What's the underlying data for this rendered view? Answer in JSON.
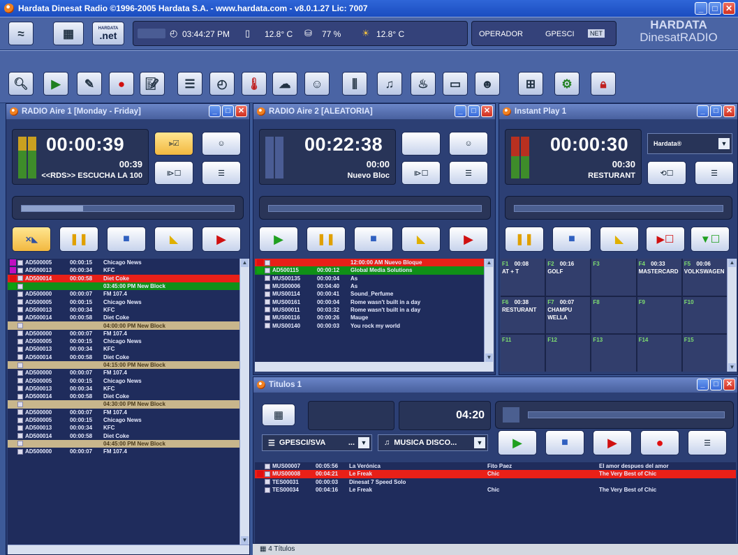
{
  "window": {
    "title": "Hardata Dinesat Radio ©1996-2005 Hardata S.A. - www.hardata.com - v8.0.1.27 Lic: 7007"
  },
  "infobar": {
    "net_label": ".net",
    "net_small": "HARDATA",
    "time": "03:44:27 PM",
    "temp1": "12.8° C",
    "humidity": "77 %",
    "temp2": "12.8° C",
    "operator_label": "OPERADOR",
    "operator": "GPESCI",
    "net_badge": "NET",
    "brand1": "HARDATA",
    "brand2": "DinesatRADIO"
  },
  "panels": {
    "aire1": {
      "title": "RADIO Aire 1 [Monday - Friday]",
      "clock": "00:00:39",
      "small": "00:39",
      "sub": "<<RDS>> ESCUCHA LA 100",
      "progress": 0.29,
      "rows": [
        {
          "icon": "up",
          "id": "AD500005",
          "dur": "00:00:15",
          "name": "Chicago News",
          "style": ""
        },
        {
          "icon": "up",
          "id": "AD500013",
          "dur": "00:00:34",
          "name": "KFC",
          "style": ""
        },
        {
          "icon": "pl",
          "id": "AD500014",
          "dur": "00:00:58",
          "name": "Diet Coke",
          "style": "red"
        },
        {
          "icon": "dn",
          "id": "",
          "dur": "",
          "name": "03:45:00 PM New Block",
          "style": "green"
        },
        {
          "icon": "no",
          "id": "AD500000",
          "dur": "00:00:07",
          "name": "FM 107.4",
          "style": ""
        },
        {
          "icon": "no",
          "id": "AD500005",
          "dur": "00:00:15",
          "name": "Chicago News",
          "style": ""
        },
        {
          "icon": "no",
          "id": "AD500013",
          "dur": "00:00:34",
          "name": "KFC",
          "style": ""
        },
        {
          "icon": "no",
          "id": "AD500014",
          "dur": "00:00:58",
          "name": "Diet Coke",
          "style": ""
        },
        {
          "icon": "no",
          "id": "",
          "dur": "",
          "name": "04:00:00 PM New Block",
          "style": "block"
        },
        {
          "icon": "no",
          "id": "AD500000",
          "dur": "00:00:07",
          "name": "FM 107.4",
          "style": ""
        },
        {
          "icon": "no",
          "id": "AD500005",
          "dur": "00:00:15",
          "name": "Chicago News",
          "style": ""
        },
        {
          "icon": "no",
          "id": "AD500013",
          "dur": "00:00:34",
          "name": "KFC",
          "style": ""
        },
        {
          "icon": "no",
          "id": "AD500014",
          "dur": "00:00:58",
          "name": "Diet Coke",
          "style": ""
        },
        {
          "icon": "no",
          "id": "",
          "dur": "",
          "name": "04:15:00 PM New Block",
          "style": "block"
        },
        {
          "icon": "no",
          "id": "AD500000",
          "dur": "00:00:07",
          "name": "FM 107.4",
          "style": ""
        },
        {
          "icon": "no",
          "id": "AD500005",
          "dur": "00:00:15",
          "name": "Chicago News",
          "style": ""
        },
        {
          "icon": "no",
          "id": "AD500013",
          "dur": "00:00:34",
          "name": "KFC",
          "style": ""
        },
        {
          "icon": "no",
          "id": "AD500014",
          "dur": "00:00:58",
          "name": "Diet Coke",
          "style": ""
        },
        {
          "icon": "no",
          "id": "",
          "dur": "",
          "name": "04:30:00 PM New Block",
          "style": "block"
        },
        {
          "icon": "no",
          "id": "AD500000",
          "dur": "00:00:07",
          "name": "FM 107.4",
          "style": ""
        },
        {
          "icon": "no",
          "id": "AD500005",
          "dur": "00:00:15",
          "name": "Chicago News",
          "style": ""
        },
        {
          "icon": "no",
          "id": "AD500013",
          "dur": "00:00:34",
          "name": "KFC",
          "style": ""
        },
        {
          "icon": "no",
          "id": "AD500014",
          "dur": "00:00:58",
          "name": "Diet Coke",
          "style": ""
        },
        {
          "icon": "no",
          "id": "",
          "dur": "",
          "name": "04:45:00 PM New Block",
          "style": "block"
        },
        {
          "icon": "no",
          "id": "AD500000",
          "dur": "00:00:07",
          "name": "FM 107.4",
          "style": ""
        }
      ]
    },
    "aire2": {
      "title": "RADIO Aire 2 [ALEATORIA]",
      "clock": "00:22:38",
      "small": "00:00",
      "sub": "Nuevo Bloc",
      "progress": 0.0,
      "rows": [
        {
          "icon": "pl",
          "id": "",
          "dur": "",
          "name": "12:00:00 AM Nuevo Bloque",
          "style": "red"
        },
        {
          "icon": "dn",
          "id": "AD500115",
          "dur": "00:00:12",
          "name": "Global Media Solutions",
          "style": "green"
        },
        {
          "icon": "no",
          "id": "MUS00135",
          "dur": "00:00:04",
          "name": "As",
          "style": ""
        },
        {
          "icon": "no",
          "id": "MUS00006",
          "dur": "00:04:40",
          "name": "As",
          "style": ""
        },
        {
          "icon": "no",
          "id": "MUS00114",
          "dur": "00:00:41",
          "name": "Sound_Perfume",
          "style": ""
        },
        {
          "icon": "no",
          "id": "MUS00161",
          "dur": "00:00:04",
          "name": "Rome wasn't built in a day",
          "style": ""
        },
        {
          "icon": "no",
          "id": "MUS00011",
          "dur": "00:03:32",
          "name": "Rome wasn't built in a day",
          "style": ""
        },
        {
          "icon": "no",
          "id": "MUS00116",
          "dur": "00:00:26",
          "name": "Mauge",
          "style": ""
        },
        {
          "icon": "no",
          "id": "MUS00140",
          "dur": "00:00:03",
          "name": "You rock my world",
          "style": ""
        }
      ]
    },
    "instant": {
      "title": "Instant Play 1",
      "clock": "00:00:30",
      "small": "00:30",
      "sub": "RESTURANT",
      "select": "Hardata®",
      "progress": 0.0,
      "cells": [
        {
          "k": "F1",
          "t": "00:08",
          "n": "AT + T"
        },
        {
          "k": "F2",
          "t": "00:16",
          "n": "GOLF"
        },
        {
          "k": "F3",
          "t": "",
          "n": ""
        },
        {
          "k": "F4",
          "t": "00:33",
          "n": "MASTERCARD"
        },
        {
          "k": "F5",
          "t": "00:06",
          "n": "VOLKSWAGEN"
        },
        {
          "k": "F6",
          "t": "00:38",
          "n": "RESTURANT"
        },
        {
          "k": "F7",
          "t": "00:07",
          "n": "CHAMPU WELLA"
        },
        {
          "k": "F8",
          "t": "",
          "n": ""
        },
        {
          "k": "F9",
          "t": "",
          "n": ""
        },
        {
          "k": "F10",
          "t": "",
          "n": ""
        },
        {
          "k": "F11",
          "t": "",
          "n": ""
        },
        {
          "k": "F12",
          "t": "",
          "n": ""
        },
        {
          "k": "F13",
          "t": "",
          "n": ""
        },
        {
          "k": "F14",
          "t": "",
          "n": ""
        },
        {
          "k": "F15",
          "t": "",
          "n": ""
        }
      ]
    },
    "titulos": {
      "title": "Titulos 1",
      "time": "04:20",
      "dd1": "GPESCI/SVA",
      "dd1b": "...",
      "dd2": "MUSICA DISCO...",
      "rows": [
        {
          "icon": "no",
          "id": "MUS00007",
          "dur": "00:05:56",
          "name": "La Verónica",
          "artist": "Fito Paez",
          "album": "El amor despues del amor",
          "style": ""
        },
        {
          "icon": "pl",
          "id": "MUS00008",
          "dur": "00:04:21",
          "name": "Le Freak",
          "artist": "Chic",
          "album": "The Very Best of Chic",
          "style": "red"
        },
        {
          "icon": "no",
          "id": "TES00031",
          "dur": "00:00:03",
          "name": "Dinesat 7 Speed Solo",
          "artist": "",
          "album": "",
          "style": ""
        },
        {
          "icon": "no",
          "id": "TES00034",
          "dur": "00:04:16",
          "name": "Le Freak",
          "artist": "Chic",
          "album": "The Very Best of Chic",
          "style": ""
        }
      ],
      "status": "4 Títulos"
    }
  }
}
